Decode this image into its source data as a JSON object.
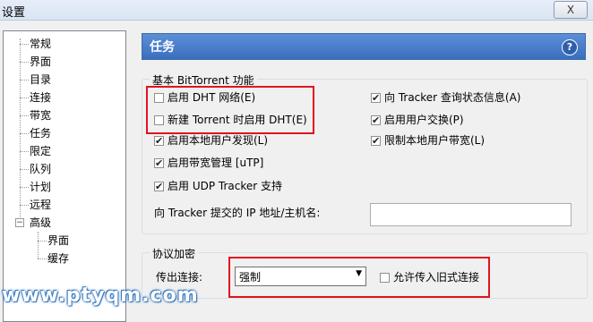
{
  "window": {
    "title": "设置",
    "close_label": "X"
  },
  "sidebar": {
    "items": [
      {
        "label": "常规"
      },
      {
        "label": "界面"
      },
      {
        "label": "目录"
      },
      {
        "label": "连接"
      },
      {
        "label": "带宽"
      },
      {
        "label": "任务"
      },
      {
        "label": "限定"
      },
      {
        "label": "队列"
      },
      {
        "label": "计划"
      },
      {
        "label": "远程"
      },
      {
        "label": "高级"
      },
      {
        "label": "界面"
      },
      {
        "label": "缓存"
      }
    ]
  },
  "header": {
    "title": "任务",
    "help_icon": "?"
  },
  "bittorrent": {
    "group_label": "基本 BitTorrent 功能",
    "options": [
      {
        "label": "启用 DHT 网络(E)",
        "checked": false
      },
      {
        "label": "新建 Torrent 时启用 DHT(E)",
        "checked": false
      },
      {
        "label": "启用本地用户发现(L)",
        "checked": true
      },
      {
        "label": "启用带宽管理 [uTP]",
        "checked": true
      },
      {
        "label": "启用 UDP Tracker 支持",
        "checked": true
      },
      {
        "label": "向 Tracker 查询状态信息(A)",
        "checked": true
      },
      {
        "label": "启用用户交换(P)",
        "checked": true
      },
      {
        "label": "限制本地用户带宽(L)",
        "checked": true
      }
    ],
    "ip_label": "向 Tracker 提交的 IP 地址/主机名:",
    "ip_value": ""
  },
  "encryption": {
    "group_label": "协议加密",
    "outgoing_label": "传出连接:",
    "outgoing_value": "强制",
    "legacy_label": "允许传入旧式连接",
    "legacy_checked": false
  },
  "watermark": "www.ptyqm.com",
  "colors": {
    "header_blue": "#3a6fbf",
    "highlight_red": "#e0141e"
  }
}
